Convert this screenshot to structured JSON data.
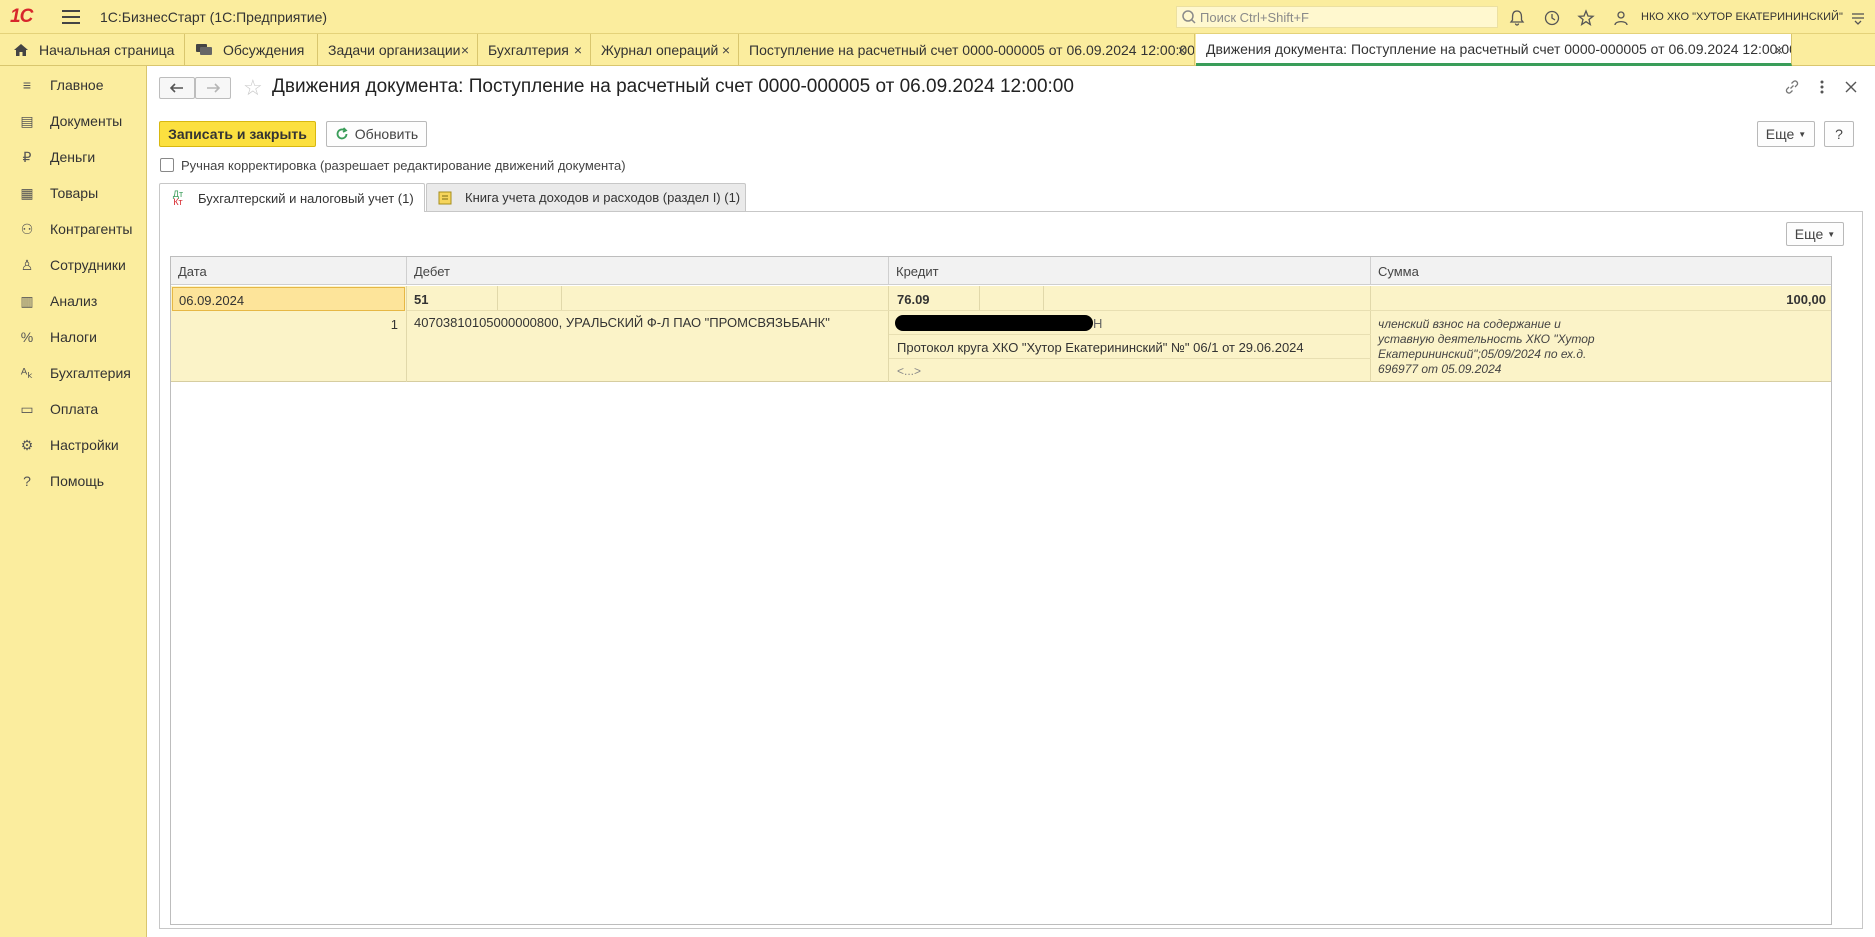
{
  "app": {
    "logo": "1С",
    "title": "1С:БизнесСтарт  (1С:Предприятие)",
    "search_placeholder": "Поиск Ctrl+Shift+F",
    "org": "НКО ХКО \"ХУТОР ЕКАТЕРИНИНСКИЙ\""
  },
  "tabs": [
    {
      "label": "Начальная страница"
    },
    {
      "label": "Обсуждения"
    },
    {
      "label": "Задачи организации"
    },
    {
      "label": "Бухгалтерия"
    },
    {
      "label": "Журнал операций"
    },
    {
      "label": "Поступление на расчетный счет 0000-000005 от 06.09.2024 12:00:00"
    },
    {
      "label": "Движения документа: Поступление на расчетный счет 0000-000005 от 06.09.2024 12:00:00"
    }
  ],
  "tab_close": "×",
  "sidebar": [
    {
      "label": "Главное",
      "icon": "≡"
    },
    {
      "label": "Документы",
      "icon": "▤"
    },
    {
      "label": "Деньги",
      "icon": "₽"
    },
    {
      "label": "Товары",
      "icon": "▦"
    },
    {
      "label": "Контрагенты",
      "icon": "⚇"
    },
    {
      "label": "Сотрудники",
      "icon": "♙"
    },
    {
      "label": "Анализ",
      "icon": "▥"
    },
    {
      "label": "Налоги",
      "icon": "%"
    },
    {
      "label": "Бухгалтерия",
      "icon": "ᴬₖ"
    },
    {
      "label": "Оплата",
      "icon": "▭"
    },
    {
      "label": "Настройки",
      "icon": "⚙"
    },
    {
      "label": "Помощь",
      "icon": "?"
    }
  ],
  "document": {
    "title": "Движения документа: Поступление на расчетный счет 0000-000005 от 06.09.2024 12:00:00",
    "save_close": "Записать и закрыть",
    "refresh": "Обновить",
    "more": "Еще",
    "help": "?",
    "manual_edit": "Ручная корректировка (разрешает редактирование движений документа)"
  },
  "subtabs": [
    {
      "label": "Бухгалтерский и налоговый учет (1)"
    },
    {
      "label": "Книга учета доходов и расходов (раздел I) (1)"
    }
  ],
  "grid": {
    "more": "Еще",
    "headers": {
      "date": "Дата",
      "debit": "Дебет",
      "credit": "Кредит",
      "sum": "Сумма"
    },
    "row": {
      "date": "06.09.2024",
      "number": "1",
      "debit_account": "51",
      "debit_sub1": "40703810105000000800, УРАЛЬСКИЙ Ф-Л ПАО \"ПРОМСВЯЗЬБАНК\"",
      "credit_account": "76.09",
      "credit_sub1_tail": "Н",
      "credit_sub2": "Протокол круга ХКО \"Хутор Екатерининский\" №\" 06/1 от 29.06.2024",
      "credit_sub3": "<...>",
      "sum": "100,00",
      "note": "членский взнос на содержание и уставную деятельность ХКО \"Хутор Екатерининский\";05/09/2024 по ех.д. 696977 от 05.09.2024"
    }
  }
}
